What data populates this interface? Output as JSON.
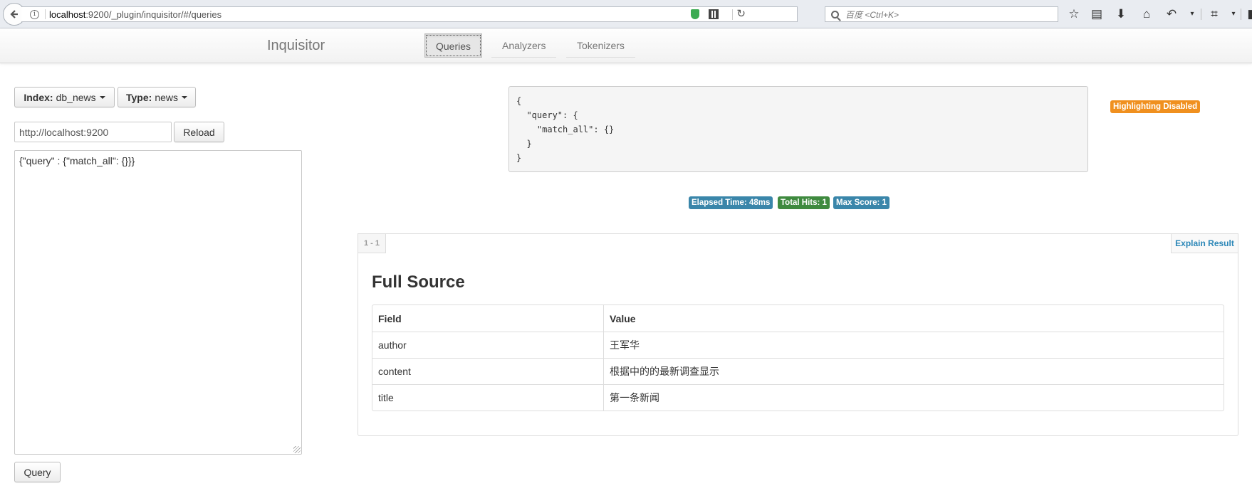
{
  "browser": {
    "url_host": "localhost",
    "url_rest": ":9200/_plugin/inquisitor/#/queries",
    "search_placeholder": "百度 <Ctrl+K>"
  },
  "nav": {
    "brand": "Inquisitor",
    "tabs": [
      "Queries",
      "Analyzers",
      "Tokenizers"
    ],
    "active_tab": "Queries"
  },
  "controls": {
    "index_label": "Index:",
    "index_value": "db_news",
    "type_label": "Type:",
    "type_value": "news",
    "host_value": "http://localhost:9200",
    "reload_label": "Reload",
    "query_text": "{\"query\" : {\"match_all\": {}}}",
    "query_button": "Query"
  },
  "query_preview": "{\n  \"query\": {\n    \"match_all\": {}\n  }\n}",
  "badges": {
    "highlighting": "Highlighting Disabled",
    "elapsed": "Elapsed Time: 48ms",
    "total_hits": "Total Hits: 1",
    "max_score": "Max Score: 1"
  },
  "results": {
    "page_range": "1 - 1",
    "explain_label": "Explain Result",
    "heading": "Full Source",
    "columns": [
      "Field",
      "Value"
    ],
    "rows": [
      {
        "field": "author",
        "value": "王军华"
      },
      {
        "field": "content",
        "value": "根据中的的最新调查显示"
      },
      {
        "field": "title",
        "value": "第一条新闻"
      }
    ]
  },
  "colors": {
    "warning": "#f0901f",
    "info": "#3a86aa",
    "success": "#3f8a3f",
    "link": "#2a86b7"
  }
}
